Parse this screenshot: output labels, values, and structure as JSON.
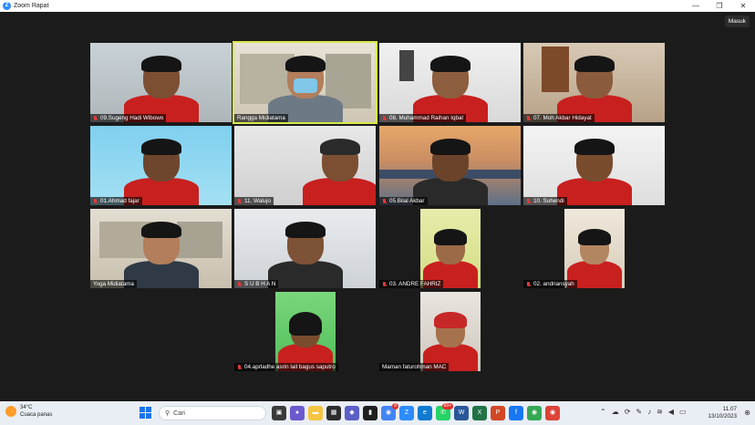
{
  "window": {
    "app_icon": "zoom-icon",
    "title": "Zoom Rapat",
    "controls": [
      "minimize-icon",
      "maximize-icon",
      "close-icon"
    ]
  },
  "meeting": {
    "sign_in_label": "Masuk",
    "active_speaker": "Rangga Midiatama",
    "participants": [
      {
        "name": "09.Sugeng Hadi Wibowo",
        "muted": true
      },
      {
        "name": "Rangga Midiatama",
        "muted": false
      },
      {
        "name": "08. Muhammad Raihan Iqbal",
        "muted": true
      },
      {
        "name": "07. Moh Akbar Hidayat",
        "muted": true
      },
      {
        "name": "01.Ahmad fajar",
        "muted": true
      },
      {
        "name": "11. Walujo",
        "muted": true
      },
      {
        "name": "05.Bilal Akbar",
        "muted": true
      },
      {
        "name": "10. Suhendi",
        "muted": true
      },
      {
        "name": "Yoga Midiatama",
        "muted": false
      },
      {
        "name": "S U B H A N",
        "muted": true
      },
      {
        "name": "03. ANDRE FAHRIZ",
        "muted": true
      },
      {
        "name": "02. andriansyah",
        "muted": true
      },
      {
        "name": "04.aprladhe asrin lail bagus saputro",
        "muted": true
      },
      {
        "name": "Maman faturohman MAC",
        "muted": false
      }
    ]
  },
  "taskbar": {
    "weather": {
      "temp": "34°C",
      "desc": "Cuaca panas"
    },
    "search_placeholder": "Cari",
    "badges": {
      "chrome": "8",
      "whatsapp": "99+"
    },
    "clock": {
      "time": "11.07",
      "date": "13/10/2023"
    },
    "colors": {
      "accent": "#2d8cff",
      "muted_mic": "#e03a3a",
      "active_outline": "#d6e84a",
      "uniform": "#c8201f"
    }
  }
}
